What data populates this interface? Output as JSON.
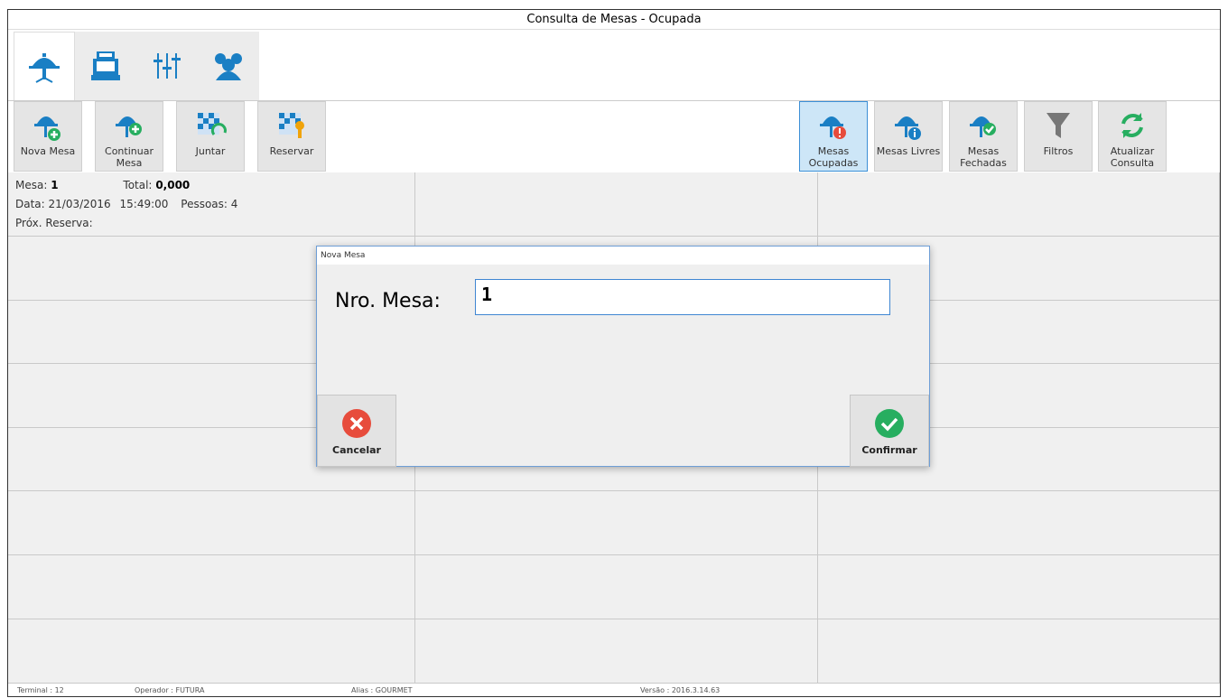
{
  "window": {
    "title": "Consulta de Mesas - Ocupada"
  },
  "topnav": {
    "tabs": [
      {
        "icon": "table-icon"
      },
      {
        "icon": "cash-register-icon"
      },
      {
        "icon": "sliders-icon"
      },
      {
        "icon": "users-icon"
      }
    ]
  },
  "toolbar": {
    "nova_mesa": "Nova Mesa",
    "continuar_mesa": "Continuar\nMesa",
    "juntar": "Juntar",
    "reservar": "Reservar",
    "mesas_ocupadas": "Mesas\nOcupadas",
    "mesas_livres": "Mesas Livres",
    "mesas_fechadas": "Mesas\nFechadas",
    "filtros": "Filtros",
    "atualizar_consulta": "Atualizar\nConsulta"
  },
  "tables": [
    {
      "mesa_label": "Mesa:",
      "mesa_value": "1",
      "total_label": "Total:",
      "total_value": "0,000",
      "data_label": "Data:",
      "data_value": "21/03/2016",
      "hora_value": "15:49:00",
      "pessoas_label": "Pessoas:",
      "pessoas_value": "4",
      "reserva_label": "Próx. Reserva:"
    }
  ],
  "dialog": {
    "title": "Nova Mesa",
    "label": "Nro. Mesa:",
    "value": "1",
    "cancel": "Cancelar",
    "confirm": "Confirmar"
  },
  "status": {
    "terminal_label": "Terminal :",
    "terminal_value": "12",
    "operador_label": "Operador :",
    "operador_value": "FUTURA",
    "alias_label": "Alias :",
    "alias_value": "GOURMET",
    "versao_label": "Versão :",
    "versao_value": "2016.3.14.63"
  },
  "colors": {
    "accent": "#3c8fd6",
    "table_blue": "#1a7fc4",
    "ok_green": "#27ae60",
    "cancel_red": "#e74c3c"
  }
}
